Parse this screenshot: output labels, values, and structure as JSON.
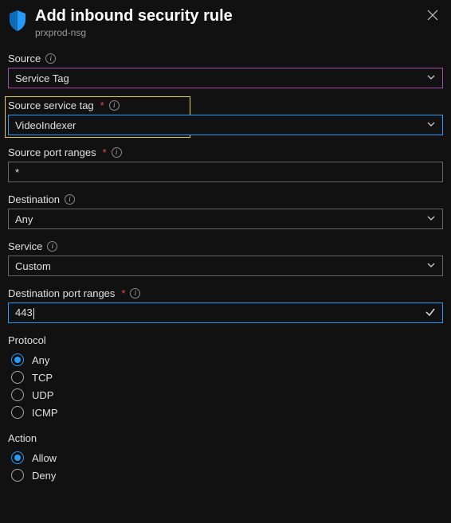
{
  "header": {
    "title": "Add inbound security rule",
    "subtitle": "prxprod-nsg"
  },
  "fields": {
    "source": {
      "label": "Source",
      "value": "Service Tag",
      "required": false,
      "info": true
    },
    "source_service_tag": {
      "label": "Source service tag",
      "value": "VideoIndexer",
      "required": true,
      "info": true
    },
    "source_port_ranges": {
      "label": "Source port ranges",
      "value": "*",
      "required": true,
      "info": true
    },
    "destination": {
      "label": "Destination",
      "value": "Any",
      "required": false,
      "info": true
    },
    "service": {
      "label": "Service",
      "value": "Custom",
      "required": false,
      "info": true
    },
    "destination_port_ranges": {
      "label": "Destination port ranges",
      "value": "443",
      "required": true,
      "info": true
    }
  },
  "protocol": {
    "label": "Protocol",
    "selected": "Any",
    "options": [
      "Any",
      "TCP",
      "UDP",
      "ICMP"
    ]
  },
  "action": {
    "label": "Action",
    "selected": "Allow",
    "options": [
      "Allow",
      "Deny"
    ]
  }
}
